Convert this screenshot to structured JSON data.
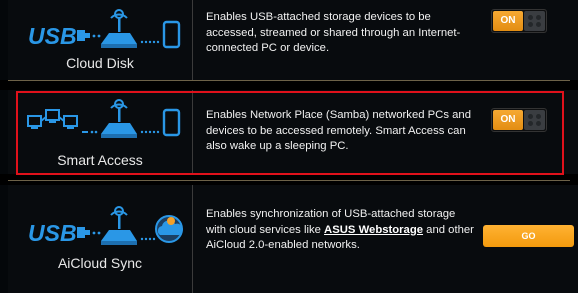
{
  "features": [
    {
      "name": "Cloud Disk",
      "description": "Enables USB-attached storage devices to be accessed, streamed or shared through an Internet-connected PC or device.",
      "control": {
        "type": "toggle",
        "label": "ON"
      }
    },
    {
      "name": "Smart Access",
      "description": "Enables Network Place (Samba) networked PCs and devices to be accessed remotely. Smart Access can also wake up a sleeping PC.",
      "control": {
        "type": "toggle",
        "label": "ON"
      },
      "highlighted": true
    },
    {
      "name": "AiCloud Sync",
      "description_before": "Enables synchronization of USB-attached storage with cloud services like ",
      "description_link": "ASUS Webstorage",
      "description_after": " and other AiCloud 2.0-enabled networks.",
      "control": {
        "type": "button",
        "label": "GO"
      }
    }
  ],
  "colors": {
    "accent": "#f39a0d",
    "icon_blue": "#2a97e6",
    "highlight_border": "#e0111b",
    "separator": "#6d6248"
  },
  "icons": [
    "usb-icon",
    "router-icon",
    "phone-icon",
    "network-pcs-icon",
    "cloud-icon"
  ]
}
